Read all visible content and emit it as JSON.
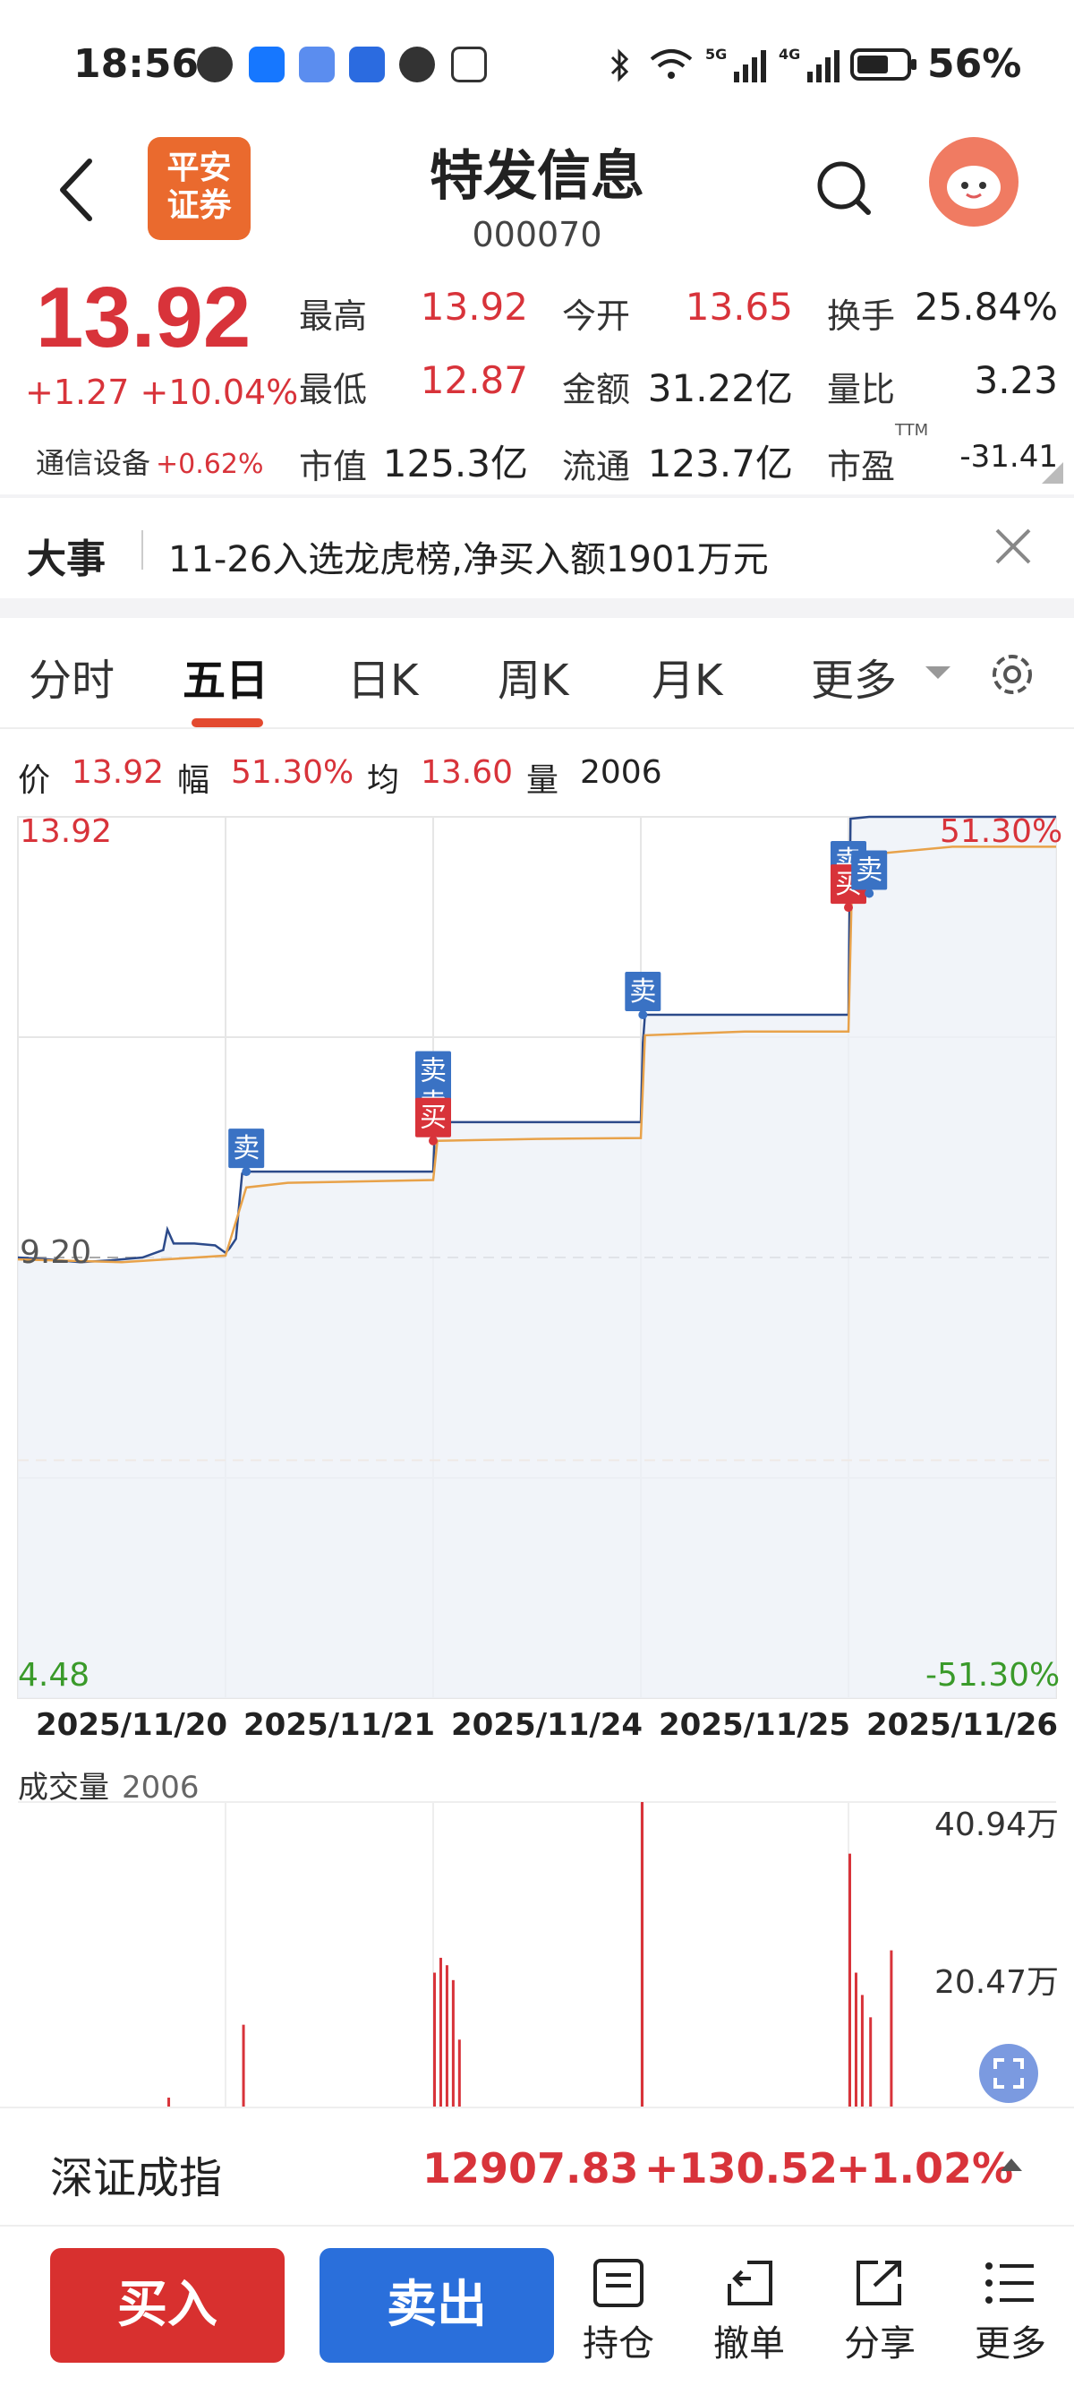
{
  "status_bar": {
    "time": "18:56",
    "battery": "56%"
  },
  "header": {
    "name": "特发信息",
    "code": "000070",
    "logo_text": "平安\n证券"
  },
  "quote": {
    "price": "13.92",
    "change": "+1.27",
    "change_pct": "+10.04%",
    "sector_name": "通信设备",
    "sector_pct": "+0.62%",
    "rows": [
      [
        {
          "label": "最高",
          "value": "13.92"
        },
        {
          "label": "今开",
          "value": "13.65"
        },
        {
          "label": "换手",
          "value": "25.84%"
        }
      ],
      [
        {
          "label": "最低",
          "value": "12.87"
        },
        {
          "label": "金额",
          "value": "31.22亿"
        },
        {
          "label": "量比",
          "value": "3.23"
        }
      ],
      [
        {
          "label": "市值",
          "value": "125.3亿"
        },
        {
          "label": "流通",
          "value": "123.7亿"
        },
        {
          "label": "市盈",
          "value": "-31.41"
        }
      ]
    ],
    "ttm": "TTM"
  },
  "news": {
    "tag": "大事",
    "text": "11-26入选龙虎榜,净买入额1901万元"
  },
  "tabs": [
    "分时",
    "五日",
    "日K",
    "周K",
    "月K",
    "更多"
  ],
  "active_tab": "五日",
  "info": {
    "price_label": "价",
    "price": "13.92",
    "range_label": "幅",
    "range": "51.30%",
    "avg_label": "均",
    "avg": "13.60",
    "vol_label": "量",
    "vol": "2006"
  },
  "chart_data": {
    "type": "line",
    "title": "",
    "y_top": "13.92",
    "y_mid": "9.20",
    "y_bottom": "4.48",
    "pct_top": "51.30%",
    "pct_bottom": "-51.30%",
    "ylim": [
      4.48,
      13.92
    ],
    "days": [
      "2025/11/20",
      "2025/11/21",
      "2025/11/24",
      "2025/11/25",
      "2025/11/26"
    ],
    "series": [
      {
        "name": "价",
        "color": "#2c4a8a",
        "points": [
          [
            0,
            9.2
          ],
          [
            0.15,
            9.18
          ],
          [
            0.3,
            9.15
          ],
          [
            0.45,
            9.17
          ],
          [
            0.6,
            9.2
          ],
          [
            0.7,
            9.28
          ],
          [
            0.72,
            9.5
          ],
          [
            0.75,
            9.35
          ],
          [
            0.85,
            9.35
          ],
          [
            0.95,
            9.33
          ],
          [
            1.0,
            9.25
          ],
          [
            1.02,
            9.3
          ],
          [
            1.05,
            9.4
          ],
          [
            1.08,
            10.1
          ],
          [
            1.1,
            10.12
          ],
          [
            1.5,
            10.12
          ],
          [
            2.0,
            10.12
          ],
          [
            2.01,
            10.65
          ],
          [
            2.05,
            10.65
          ],
          [
            2.5,
            10.65
          ],
          [
            3.0,
            10.65
          ],
          [
            3.01,
            11.5
          ],
          [
            3.02,
            11.8
          ],
          [
            3.05,
            11.8
          ],
          [
            3.5,
            11.8
          ],
          [
            4.0,
            11.8
          ],
          [
            4.01,
            13.9
          ],
          [
            4.1,
            13.92
          ],
          [
            5.0,
            13.92
          ]
        ]
      },
      {
        "name": "均",
        "color": "#e8a24a",
        "points": [
          [
            0,
            9.18
          ],
          [
            0.5,
            9.15
          ],
          [
            1.0,
            9.22
          ],
          [
            1.1,
            9.95
          ],
          [
            1.3,
            10.0
          ],
          [
            2.0,
            10.03
          ],
          [
            2.02,
            10.45
          ],
          [
            2.5,
            10.47
          ],
          [
            3.0,
            10.48
          ],
          [
            3.02,
            11.58
          ],
          [
            3.5,
            11.62
          ],
          [
            4.0,
            11.62
          ],
          [
            4.02,
            13.5
          ],
          [
            4.5,
            13.6
          ],
          [
            5.0,
            13.6
          ]
        ]
      }
    ],
    "markers": [
      {
        "type": "sell",
        "label": "卖",
        "day": 1.1,
        "price": 10.12
      },
      {
        "type": "sell",
        "label": "卖",
        "day": 2.0,
        "price": 10.95
      },
      {
        "type": "sell",
        "label": "卖",
        "day": 2.0,
        "price": 10.6
      },
      {
        "type": "buy",
        "label": "买",
        "day": 2.0,
        "price": 10.45
      },
      {
        "type": "sell",
        "label": "卖",
        "day": 3.01,
        "price": 11.8
      },
      {
        "type": "sell",
        "label": "卖",
        "day": 4.0,
        "price": 13.2
      },
      {
        "type": "buy",
        "label": "买",
        "day": 4.0,
        "price": 12.95
      },
      {
        "type": "sell",
        "label": "卖",
        "day": 4.1,
        "price": 13.1
      }
    ],
    "volume": {
      "title": "成交量",
      "value": "2006",
      "ticks": [
        "40.94万",
        "20.47万"
      ],
      "ymax": 409400,
      "bars": [
        [
          0.72,
          12000
        ],
        [
          1.08,
          110000
        ],
        [
          2.0,
          180000
        ],
        [
          2.03,
          200000
        ],
        [
          2.06,
          190000
        ],
        [
          2.09,
          170000
        ],
        [
          2.12,
          90000
        ],
        [
          3.0,
          409400
        ],
        [
          4.0,
          340000
        ],
        [
          4.03,
          180000
        ],
        [
          4.06,
          150000
        ],
        [
          4.1,
          120000
        ],
        [
          4.2,
          210000
        ]
      ]
    }
  },
  "index_bar": {
    "name": "深证成指",
    "value": "12907.83",
    "change": "+130.52",
    "pct": "+1.02%"
  },
  "actions": {
    "buy": "买入",
    "sell": "卖出",
    "items": [
      "持仓",
      "撤单",
      "分享",
      "更多"
    ]
  }
}
